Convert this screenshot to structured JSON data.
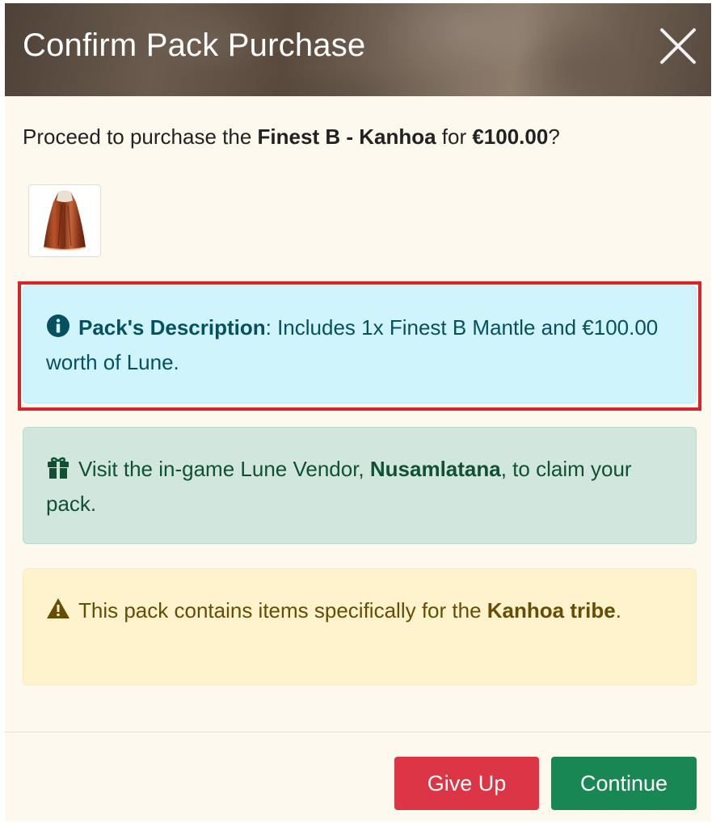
{
  "modal": {
    "title": "Confirm Pack Purchase",
    "close_icon": "close-icon"
  },
  "prompt": {
    "prefix": "Proceed to purchase the ",
    "pack_name": "Finest B - Kanhoa",
    "middle": " for ",
    "price": "€100.00",
    "suffix": "?"
  },
  "pack_image": {
    "icon": "mantle-item-icon"
  },
  "alerts": {
    "info": {
      "icon": "info-circle-icon",
      "label": "Pack's Description",
      "text": ": Includes 1x Finest B Mantle and €100.00 worth of Lune."
    },
    "success": {
      "icon": "gift-icon",
      "prefix": "Visit the in-game Lune Vendor, ",
      "vendor": "Nusamlatana",
      "suffix": ", to claim your pack."
    },
    "warning": {
      "icon": "warning-triangle-icon",
      "prefix": "This pack contains items specifically for the ",
      "tribe": "Kanhoa tribe",
      "suffix": "."
    }
  },
  "buttons": {
    "give_up": "Give Up",
    "continue": "Continue"
  },
  "colors": {
    "highlight_border": "#d9232b",
    "give_up": "#dc3545",
    "continue": "#198754",
    "info_bg": "#cff4fc",
    "success_bg": "#d1e7dd",
    "warning_bg": "#fff3cd"
  }
}
